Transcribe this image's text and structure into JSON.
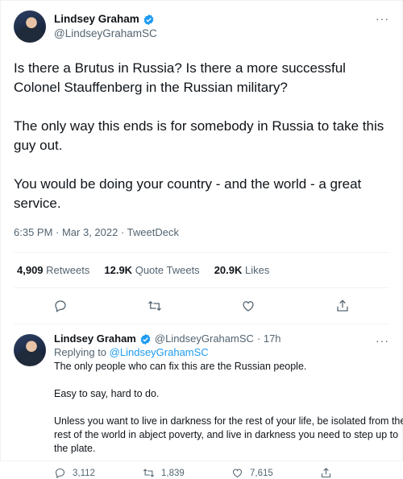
{
  "tweet": {
    "author": {
      "name": "Lindsey Graham",
      "handle": "@LindseyGrahamSC"
    },
    "paragraphs": [
      "Is there a Brutus in Russia?  Is there a more successful Colonel Stauffenberg in the Russian military?",
      "The only way this ends is for somebody in Russia to take this guy out.",
      "You would be doing your country - and the world - a great service."
    ],
    "time": "6:35 PM · Mar 3, 2022 · TweetDeck",
    "stats": {
      "retweets_count": "4,909",
      "retweets_label": "Retweets",
      "quotes_count": "12.9K",
      "quotes_label": "Quote Tweets",
      "likes_count": "20.9K",
      "likes_label": "Likes"
    },
    "more": "···",
    "icons": [
      "reply-icon",
      "retweet-icon",
      "like-icon",
      "share-icon",
      "verified-icon",
      "more-icon"
    ]
  },
  "reply": {
    "author": {
      "name": "Lindsey Graham",
      "handle": "@LindseyGrahamSC",
      "time": "· 17h"
    },
    "replying_prefix": "Replying to",
    "replying_handle": "@LindseyGrahamSC",
    "paragraphs": [
      "The only people who can fix this are the Russian people.",
      "Easy to say, hard to do.",
      "Unless you want to live in darkness for the rest of your life, be isolated from the rest of the world in abject poverty, and live in darkness you need to step up to the plate."
    ],
    "actions": {
      "replies": "3,112",
      "retweets": "1,839",
      "likes": "7,615"
    },
    "more": "···"
  },
  "colors": {
    "accent": "#1d9bf0",
    "secondary_text": "#536471",
    "text": "#0f1419"
  }
}
